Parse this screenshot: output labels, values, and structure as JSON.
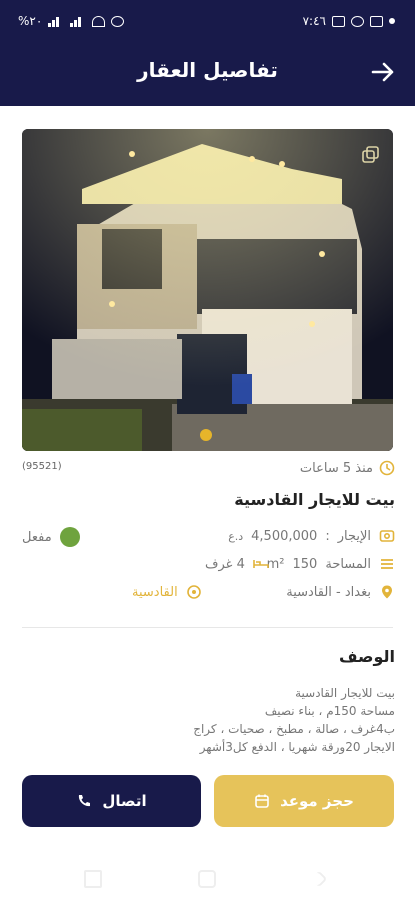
{
  "status_bar": {
    "time": "٧:٤٦",
    "battery": "%٢٠"
  },
  "header": {
    "title": "تفاصيل العقار",
    "back_icon": "arrow-right-icon"
  },
  "photo": {
    "alt": "house-exterior-night",
    "expand_icon": "expand-icon"
  },
  "property": {
    "ref_id": "(95521)",
    "posted": "منذ 5 ساعات",
    "title": "بيت للايجار القادسية",
    "rent_label": "الإيجار",
    "rent_value": "4,500,000",
    "currency": "د.ع",
    "status": "مفعل",
    "area_label": "المساحة",
    "area_value": "150",
    "area_unit": "m²",
    "rooms": "4 غرف",
    "location": "بغداد - القادسية",
    "district": "القادسية"
  },
  "description": {
    "title": "الوصف",
    "text": "بيت للايجار القادسية\nمساحة 150م ، بناء نصيف\nب4غرف ، صالة ، مطبخ ، صحيات ، كراج\nالايجار 20ورقة شهريا ، الدفع كل3أشهر"
  },
  "actions": {
    "call": "اتصال",
    "book": "حجز موعد"
  },
  "colors": {
    "primary": "#181a4a",
    "accent": "#e6c35a",
    "gold_icon": "#e2b43a",
    "active": "#6fa33e"
  }
}
